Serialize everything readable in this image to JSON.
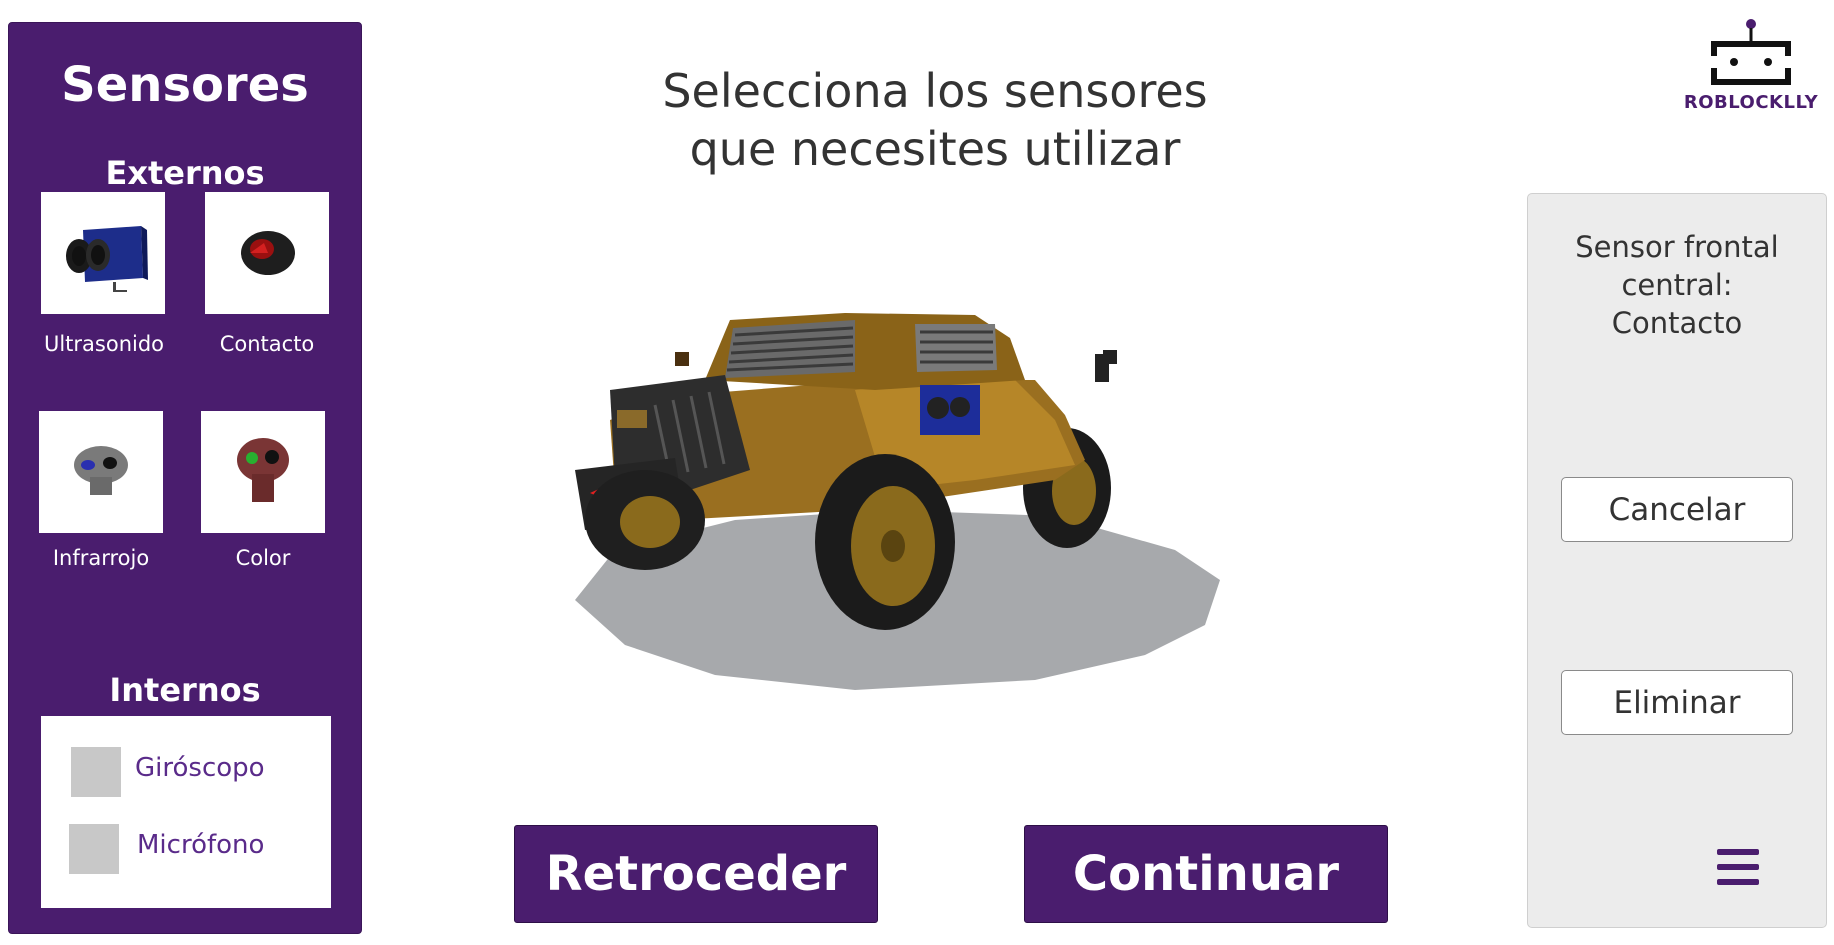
{
  "sidebar": {
    "title": "Sensores",
    "external_title": "Externos",
    "external_sensors": [
      {
        "label": "Ultrasonido",
        "icon": "ultrasonic-sensor-icon"
      },
      {
        "label": "Contacto",
        "icon": "contact-sensor-icon"
      },
      {
        "label": "Infrarrojo",
        "icon": "infrared-sensor-icon"
      },
      {
        "label": "Color",
        "icon": "color-sensor-icon"
      }
    ],
    "internal_title": "Internos",
    "internal_sensors": [
      {
        "label": "Giróscopo",
        "checked": false
      },
      {
        "label": "Micrófono",
        "checked": false
      }
    ]
  },
  "main": {
    "headline_line1": "Selecciona los sensores",
    "headline_line2": "que necesites utilizar",
    "back_button": "Retroceder",
    "continue_button": "Continuar"
  },
  "logo": {
    "text": "ROBLOCKLLY"
  },
  "right_panel": {
    "info_line1": "Sensor frontal",
    "info_line2": "central:",
    "info_line3": "Contacto",
    "cancel_button": "Cancelar",
    "delete_button": "Eliminar",
    "menu_icon": "hamburger-menu-icon"
  },
  "colors": {
    "brand_purple": "#4a1d6e",
    "panel_gray": "#ececec",
    "checkbox_gray": "#c8c8c8"
  }
}
